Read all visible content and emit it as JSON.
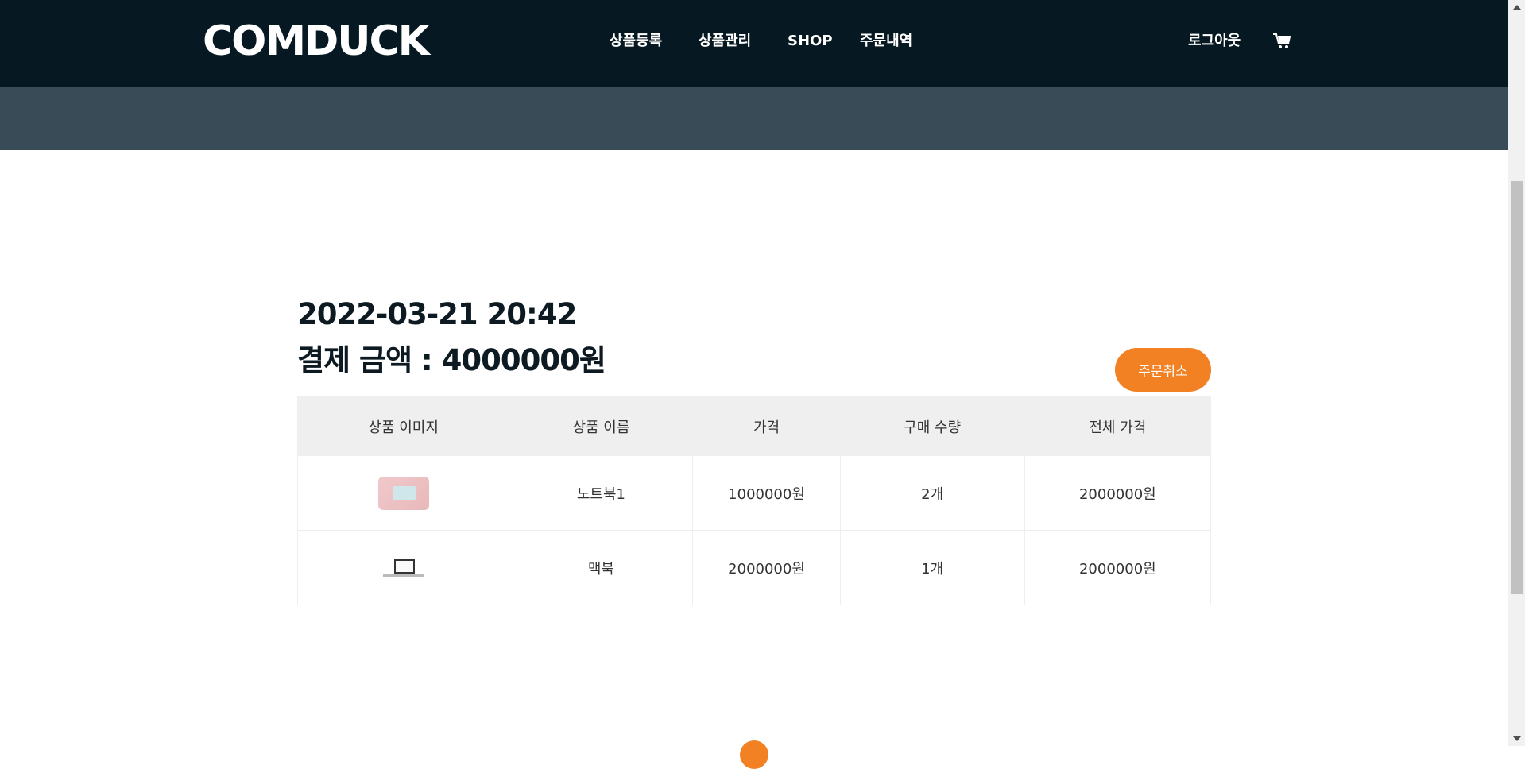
{
  "header": {
    "logo": "COMDUCK",
    "nav": [
      {
        "label": "상품등록"
      },
      {
        "label": "상품관리"
      },
      {
        "label": "SHOP"
      },
      {
        "label": "주문내역"
      }
    ],
    "logout_label": "로그아웃",
    "cart_icon": "cart-icon"
  },
  "order": {
    "date": "2022-03-21 20:42",
    "total_label": "결제 금액 : 4000000원",
    "cancel_label": "주문취소",
    "columns": [
      "상품 이미지",
      "상품 이름",
      "가격",
      "구매 수량",
      "전체 가격"
    ],
    "rows": [
      {
        "image": "notebook-thumbnail",
        "name": "노트북1",
        "price": "1000000원",
        "qty": "2개",
        "total": "2000000원"
      },
      {
        "image": "macbook-thumbnail",
        "name": "맥북",
        "price": "2000000원",
        "qty": "1개",
        "total": "2000000원"
      }
    ]
  },
  "colors": {
    "header_bg": "#061821",
    "band_bg": "#394b57",
    "accent": "#f28123"
  }
}
